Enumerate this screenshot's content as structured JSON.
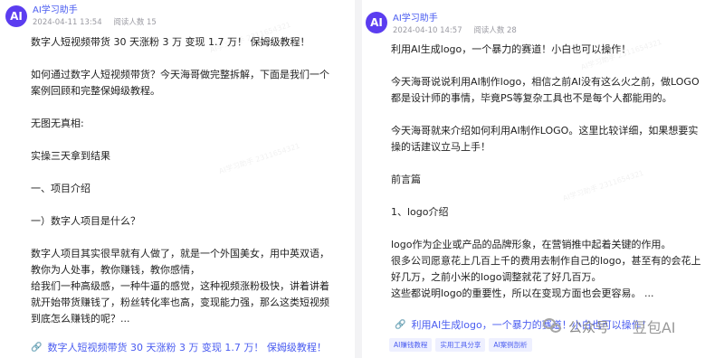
{
  "left_post": {
    "avatar_label": "AI",
    "author": "AI学习助手",
    "date": "2024-04-11 13:54",
    "reads": "阅读人数 15",
    "paragraphs": [
      "数字人短视频带货 30 天涨粉 3 万 变现 1.7 万！ 保姆级教程！",
      "",
      "如何通过数字人短视频带货？今天海哥做完整拆解，下面是我们一个案例回顾和完整保姆级教程。",
      "",
      "无图无真相:",
      "",
      "实操三天拿到结果",
      "",
      "一、项目介绍",
      "",
      "一）数字人项目是什么？",
      "",
      "数字人项目其实很早就有人做了，就是一个外国美女，用中英双语，教你为人处事，教你赚钱，教你感情，",
      "给我们一种高级感，一种牛逼的感觉，这种视频涨粉极快，讲着讲着就开始带货赚钱了，粉丝转化率也高，变现能力强，那么这类短视频到底怎么赚钱的呢？..."
    ],
    "link_text": "数字人短视频带货 30 天涨粉 3 万 变现 1.7 万！ 保姆级教程！"
  },
  "right_post": {
    "avatar_label": "AI",
    "author": "AI学习助手",
    "date": "2024-04-10 14:57",
    "reads": "阅读人数 28",
    "paragraphs": [
      "利用AI生成logo，一个暴力的赛道！小白也可以操作！",
      "",
      "今天海哥说说利用AI制作logo，相信之前AI没有这么火之前，做LOGO都是设计师的事情，毕竟PS等复杂工具也不是每个人都能用的。",
      "",
      "今天海哥就来介绍如何利用AI制作LOGO。这里比较详细，如果想要实操的话建议立马上手！",
      "",
      "前言篇",
      "",
      "1、logo介绍",
      "",
      "logo作为企业或产品的品牌形象，在营销推中起着关键的作用。",
      "很多公司愿意花上几百上千的费用去制作自己的logo，甚至有的会花上好几万，之前小米的logo调整就花了好几百万。",
      "这些都说明logo的重要性，所以在变现方面也会更容易。 ..."
    ],
    "link_text": "利用AI生成logo，一个暴力的赛道！小白也可以操作！",
    "tags": [
      "AI赚钱教程",
      "实用工具分享",
      "AI案例剖析"
    ]
  },
  "brand": {
    "wechat_label": "公众号",
    "separator": "·",
    "name": "豆包AI"
  },
  "watermark_text": "AI学习助手 2311654321",
  "colors": {
    "accent": "#4a5cf0",
    "avatar": "#5b3df0"
  }
}
